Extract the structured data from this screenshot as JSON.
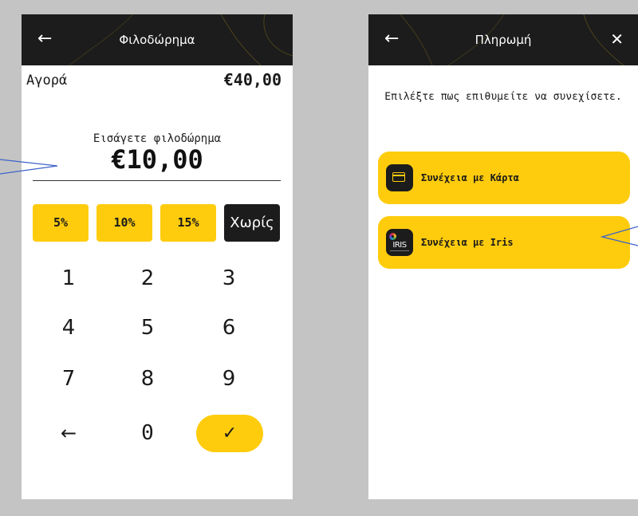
{
  "left_screen": {
    "title": "Φιλοδώρημα",
    "back_icon": "←",
    "purchase_label": "Αγορά",
    "purchase_amount": "€40,00",
    "tip_prompt": "Εισάγετε φιλοδώρημα",
    "tip_amount": "€10,00",
    "presets": [
      "5%",
      "10%",
      "15%",
      "Χωρίς"
    ],
    "keys": [
      "1",
      "2",
      "3",
      "4",
      "5",
      "6",
      "7",
      "8",
      "9",
      "←",
      "0"
    ],
    "confirm_icon": "✓"
  },
  "right_screen": {
    "title": "Πληρωμή",
    "back_icon": "←",
    "close_icon": "✕",
    "instruction": "Επιλέξτε πως επιθυμείτε να συνεχίσετε.",
    "options": [
      {
        "label": "Συνέχεια με Κάρτα",
        "icon": "card-icon"
      },
      {
        "label": "Συνέχεια με Iris",
        "icon": "iris-logo",
        "logo_text": "IRIS"
      }
    ]
  },
  "colors": {
    "accent_yellow": "#ffcc0d",
    "header_dark": "#1c1c1c",
    "background_gray": "#c4c4c4",
    "annotation_blue": "#3f63c9"
  }
}
